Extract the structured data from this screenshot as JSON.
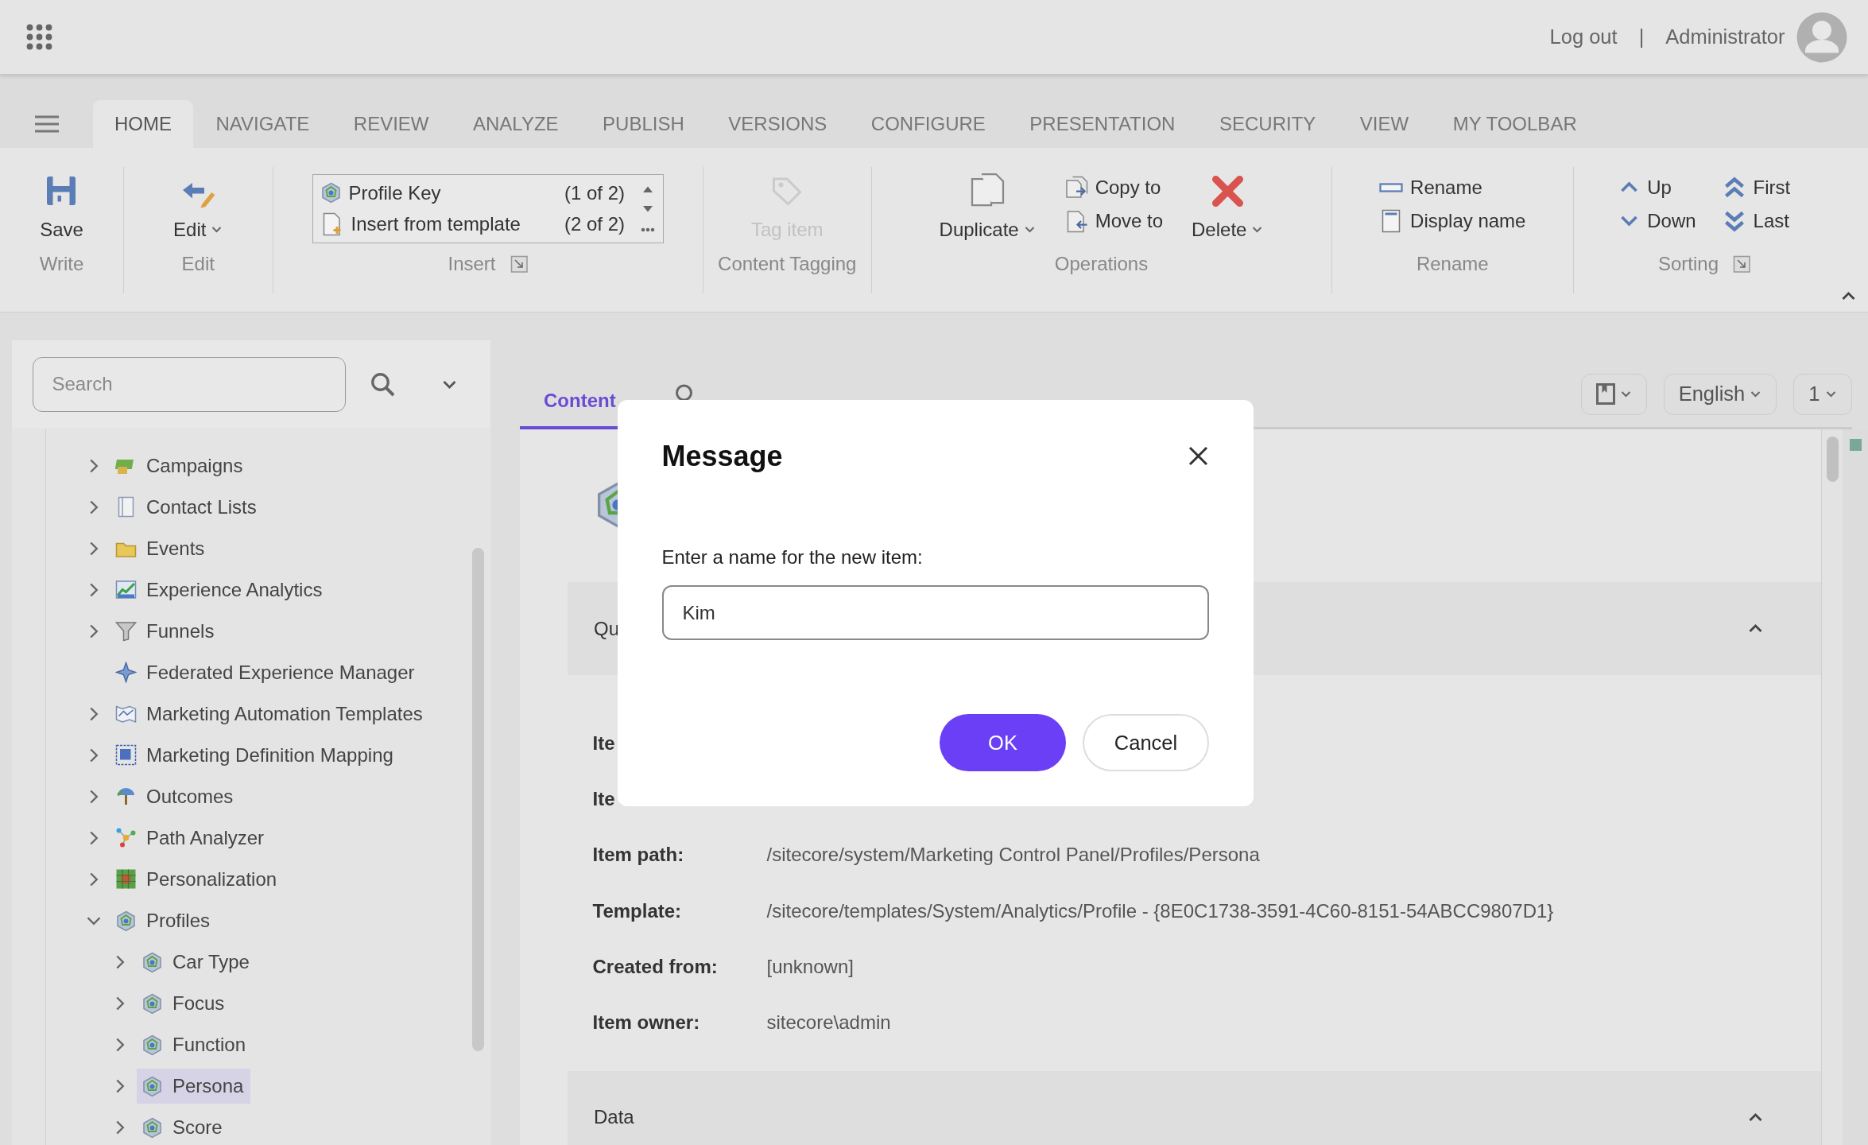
{
  "top_bar": {
    "logout": "Log out",
    "separator": "|",
    "user": "Administrator"
  },
  "ribbon_tabs": [
    {
      "label": "HOME",
      "selected": true
    },
    {
      "label": "NAVIGATE",
      "selected": false
    },
    {
      "label": "REVIEW",
      "selected": false
    },
    {
      "label": "ANALYZE",
      "selected": false
    },
    {
      "label": "PUBLISH",
      "selected": false
    },
    {
      "label": "VERSIONS",
      "selected": false
    },
    {
      "label": "CONFIGURE",
      "selected": false
    },
    {
      "label": "PRESENTATION",
      "selected": false
    },
    {
      "label": "SECURITY",
      "selected": false
    },
    {
      "label": "VIEW",
      "selected": false
    },
    {
      "label": "MY TOOLBAR",
      "selected": false
    }
  ],
  "ribbon_groups": [
    {
      "label": "Write",
      "launcher": false,
      "items": [
        {
          "kind": "large",
          "label": "Save",
          "dropdown": false,
          "disabled": false
        }
      ]
    },
    {
      "label": "Edit",
      "launcher": false,
      "items": [
        {
          "kind": "large",
          "label": "Edit",
          "dropdown": true,
          "disabled": false
        }
      ]
    },
    {
      "label": "Insert",
      "launcher": true,
      "items": [
        {
          "kind": "gallery",
          "rows": [
            {
              "label": "Profile Key",
              "count": "(1 of 2)"
            },
            {
              "label": "Insert from template",
              "count": "(2 of 2)"
            }
          ]
        }
      ]
    },
    {
      "label": "Content Tagging",
      "launcher": false,
      "items": [
        {
          "kind": "large",
          "label": "Tag item",
          "dropdown": false,
          "disabled": true
        }
      ]
    },
    {
      "label": "Operations",
      "launcher": false,
      "items": [
        {
          "kind": "large",
          "label": "Duplicate",
          "dropdown": true,
          "disabled": false
        },
        {
          "kind": "small",
          "label": "Copy to",
          "disabled": false
        },
        {
          "kind": "small",
          "label": "Move to",
          "disabled": false
        },
        {
          "kind": "large",
          "label": "Delete",
          "dropdown": true,
          "disabled": false
        }
      ]
    },
    {
      "label": "Rename",
      "launcher": false,
      "items": [
        {
          "kind": "small",
          "label": "Rename",
          "disabled": false
        },
        {
          "kind": "small",
          "label": "Display name",
          "disabled": false
        }
      ]
    },
    {
      "label": "Sorting",
      "launcher": true,
      "items": [
        {
          "kind": "small",
          "label": "Up",
          "disabled": false
        },
        {
          "kind": "small",
          "label": "Down",
          "disabled": false
        },
        {
          "kind": "small",
          "label": "First",
          "disabled": false
        },
        {
          "kind": "small",
          "label": "Last",
          "disabled": false
        }
      ]
    }
  ],
  "search": {
    "placeholder": "Search"
  },
  "tree": [
    {
      "label": "Campaigns",
      "expandable": true,
      "expanded": false,
      "selected": false
    },
    {
      "label": "Contact Lists",
      "expandable": true,
      "expanded": false,
      "selected": false
    },
    {
      "label": "Events",
      "expandable": true,
      "expanded": false,
      "selected": false
    },
    {
      "label": "Experience Analytics",
      "expandable": true,
      "expanded": false,
      "selected": false
    },
    {
      "label": "Funnels",
      "expandable": true,
      "expanded": false,
      "selected": false
    },
    {
      "label": "Federated Experience Manager",
      "expandable": false,
      "selected": false
    },
    {
      "label": "Marketing Automation Templates",
      "expandable": true,
      "expanded": false,
      "selected": false
    },
    {
      "label": "Marketing Definition Mapping",
      "expandable": true,
      "expanded": false,
      "selected": false
    },
    {
      "label": "Outcomes",
      "expandable": true,
      "expanded": false,
      "selected": false
    },
    {
      "label": "Path Analyzer",
      "expandable": true,
      "expanded": false,
      "selected": false
    },
    {
      "label": "Personalization",
      "expandable": true,
      "expanded": false,
      "selected": false
    },
    {
      "label": "Profiles",
      "expandable": true,
      "expanded": true,
      "selected": false,
      "children": [
        {
          "label": "Car Type",
          "expandable": true,
          "expanded": false,
          "selected": false
        },
        {
          "label": "Focus",
          "expandable": true,
          "expanded": false,
          "selected": false
        },
        {
          "label": "Function",
          "expandable": true,
          "expanded": false,
          "selected": false
        },
        {
          "label": "Persona",
          "expandable": true,
          "expanded": false,
          "selected": true
        },
        {
          "label": "Score",
          "expandable": true,
          "expanded": false,
          "selected": false
        }
      ]
    }
  ],
  "editor_tabs": [
    {
      "label": "Content",
      "selected": true
    }
  ],
  "language": "English",
  "version": "1",
  "sections": [
    {
      "title": "Qu",
      "expanded": true,
      "fields": [
        {
          "label": "Ite"
        },
        {
          "label": "Ite"
        },
        {
          "label": "Item path:",
          "value": "/sitecore/system/Marketing Control Panel/Profiles/Persona"
        },
        {
          "label": "Template:",
          "value": "/sitecore/templates/System/Analytics/Profile - {8E0C1738-3591-4C60-8151-54ABCC9807D1}"
        },
        {
          "label": "Created from:",
          "value": "[unknown]"
        },
        {
          "label": "Item owner:",
          "value": "sitecore\\admin"
        }
      ]
    },
    {
      "title": "Data",
      "expanded": true
    }
  ],
  "dialog": {
    "title": "Message",
    "prompt": "Enter a name for the new item:",
    "value": "Kim",
    "buttons": [
      {
        "label": "OK",
        "kind": "primary"
      },
      {
        "label": "Cancel",
        "kind": "secondary"
      }
    ]
  }
}
